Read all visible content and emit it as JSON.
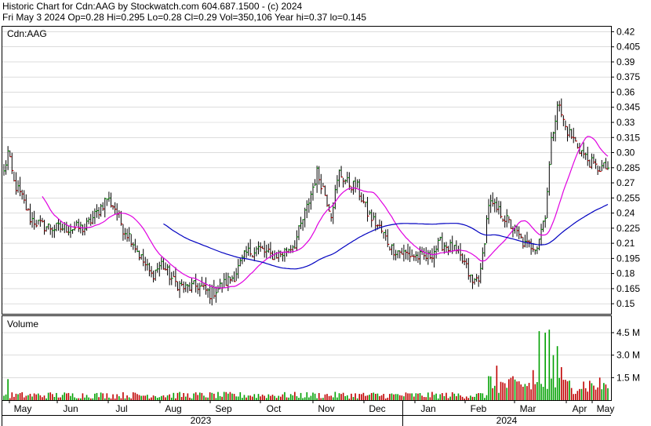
{
  "header": {
    "line1": "Historic Chart for Cdn:AAG by Stockwatch.com 604.687.1500 - (c) 2024",
    "line2": "Fri May  3 2024   Op=0.28  Hi=0.295  Lo=0.28  Cl=0.29  Vol=350,106  Year hi=0.37  lo=0.145"
  },
  "chart_data": {
    "type": "ohlc",
    "symbol_label": "Cdn:AAG",
    "volume_label": "Volume",
    "price_axis": {
      "ylim": [
        0.14,
        0.425
      ],
      "ticks": [
        "0.42",
        "0.405",
        "0.39",
        "0.375",
        "0.36",
        "0.345",
        "0.33",
        "0.315",
        "0.30",
        "0.285",
        "0.27",
        "0.255",
        "0.24",
        "0.225",
        "0.21",
        "0.195",
        "0.18",
        "0.165",
        "0.15"
      ]
    },
    "volume_axis": {
      "ylim": [
        0,
        5.6
      ],
      "ticks": [
        "4.5 M",
        "3.0 M",
        "1.5 M"
      ]
    },
    "months": [
      "May",
      "Jun",
      "Jul",
      "Aug",
      "Sep",
      "Oct",
      "Nov",
      "Dec",
      "Jan",
      "Feb",
      "Mar",
      "Apr",
      "May"
    ],
    "years": [
      "2023",
      "2024"
    ],
    "price_anchors": [
      [
        0,
        0.28
      ],
      [
        2,
        0.3
      ],
      [
        5,
        0.27
      ],
      [
        9,
        0.255
      ],
      [
        13,
        0.235
      ],
      [
        18,
        0.228
      ],
      [
        25,
        0.225
      ],
      [
        33,
        0.225
      ],
      [
        40,
        0.225
      ],
      [
        46,
        0.24
      ],
      [
        51,
        0.255
      ],
      [
        55,
        0.245
      ],
      [
        59,
        0.225
      ],
      [
        63,
        0.215
      ],
      [
        68,
        0.195
      ],
      [
        73,
        0.178
      ],
      [
        78,
        0.19
      ],
      [
        84,
        0.172
      ],
      [
        90,
        0.165
      ],
      [
        96,
        0.168
      ],
      [
        102,
        0.16
      ],
      [
        108,
        0.168
      ],
      [
        114,
        0.178
      ],
      [
        120,
        0.2
      ],
      [
        126,
        0.205
      ],
      [
        132,
        0.198
      ],
      [
        138,
        0.2
      ],
      [
        144,
        0.21
      ],
      [
        150,
        0.245
      ],
      [
        155,
        0.28
      ],
      [
        158,
        0.265
      ],
      [
        162,
        0.24
      ],
      [
        166,
        0.28
      ],
      [
        170,
        0.27
      ],
      [
        175,
        0.265
      ],
      [
        180,
        0.24
      ],
      [
        186,
        0.225
      ],
      [
        192,
        0.205
      ],
      [
        198,
        0.2
      ],
      [
        204,
        0.197
      ],
      [
        210,
        0.196
      ],
      [
        216,
        0.21
      ],
      [
        222,
        0.205
      ],
      [
        228,
        0.19
      ],
      [
        232,
        0.17
      ],
      [
        236,
        0.18
      ],
      [
        240,
        0.25
      ],
      [
        246,
        0.24
      ],
      [
        252,
        0.225
      ],
      [
        258,
        0.208
      ],
      [
        264,
        0.208
      ],
      [
        268,
        0.24
      ],
      [
        271,
        0.31
      ],
      [
        274,
        0.35
      ],
      [
        278,
        0.325
      ],
      [
        283,
        0.31
      ],
      [
        288,
        0.295
      ],
      [
        293,
        0.285
      ],
      [
        298,
        0.285
      ]
    ],
    "vol_spikes": [
      [
        2,
        1.4
      ],
      [
        240,
        1.6
      ],
      [
        244,
        2.3
      ],
      [
        262,
        2.0
      ],
      [
        265,
        4.6
      ],
      [
        268,
        4.5
      ],
      [
        270,
        4.7
      ],
      [
        272,
        3.0
      ],
      [
        274,
        3.6
      ],
      [
        276,
        2.2
      ],
      [
        280,
        1.3
      ]
    ],
    "ma_short_period": 20,
    "ma_long_period": 80,
    "colors": {
      "up": "#00a000",
      "down": "#c00000",
      "ma_short": "#e000e0",
      "ma_long": "#0000c0",
      "grid": "#c8c8c8"
    }
  }
}
